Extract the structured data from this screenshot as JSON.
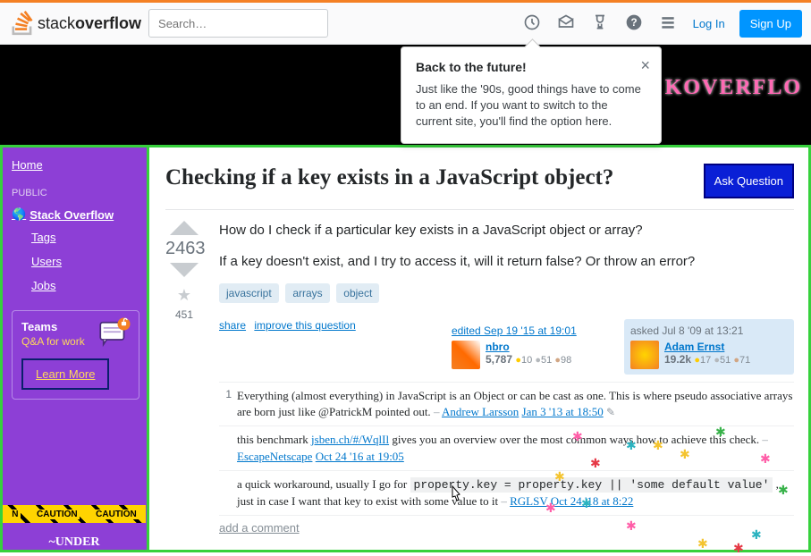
{
  "search": {
    "placeholder": "Search…"
  },
  "topbar": {
    "login": "Log In",
    "signup": "Sign Up"
  },
  "popover": {
    "title": "Back to the future!",
    "body": "Just like the '90s, good things have to come to an end. If you want to switch to the current site, you'll find the option here."
  },
  "banner": {
    "text": "KOVERFLO"
  },
  "sidebar": {
    "home": "Home",
    "public": "PUBLIC",
    "so": "Stack Overflow",
    "tags": "Tags",
    "users": "Users",
    "jobs": "Jobs",
    "teams_title": "Teams",
    "teams_sub": "Q&A for work",
    "learn": "Learn More",
    "caution": "CAUTION",
    "under": "~UNDER"
  },
  "question": {
    "title": "Checking if a key exists in a JavaScript object?",
    "ask": "Ask Question",
    "score": "2463",
    "favcount": "451",
    "p1": "How do I check if a particular key exists in a JavaScript object or array?",
    "p2": "If a key doesn't exist, and I try to access it, will it return false? Or throw an error?",
    "tags": [
      "javascript",
      "arrays",
      "object"
    ],
    "share": "share",
    "improve": "improve this question",
    "editor": {
      "action": "edited Sep 19 '15 at 19:01",
      "name": "nbro",
      "rep": "5,787",
      "gold": "10",
      "silver": "51",
      "bronze": "98"
    },
    "owner": {
      "action": "asked Jul 8 '09 at 13:21",
      "name": "Adam Ernst",
      "rep": "19.2k",
      "gold": "17",
      "silver": "51",
      "bronze": "71"
    },
    "add_comment": "add a comment"
  },
  "comments": [
    {
      "score": "1",
      "text": "Everything (almost everything) in JavaScript is an Object or can be cast as one. This is where pseudo associative arrays are born just like @PatrickM pointed out.",
      "author": "Andrew Larsson",
      "date": "Jan 3 '13 at 18:50",
      "pencil": true
    },
    {
      "score": "",
      "pre": "this benchmark ",
      "link": "jsben.ch/#/WqlIl",
      "post": " gives you an overview over the most common ways how to achieve this check.",
      "author": "EscapeNetscape",
      "date": "Oct 24 '16 at 19:05"
    },
    {
      "score": "",
      "pre": "a quick workaround, usually I go for ",
      "code": "property.key = property.key || 'some default value'",
      "post": " , just in case I want that key to exist with some value to it",
      "author": "RGLSV",
      "date": "Oct 24 '18 at 8:22"
    }
  ]
}
